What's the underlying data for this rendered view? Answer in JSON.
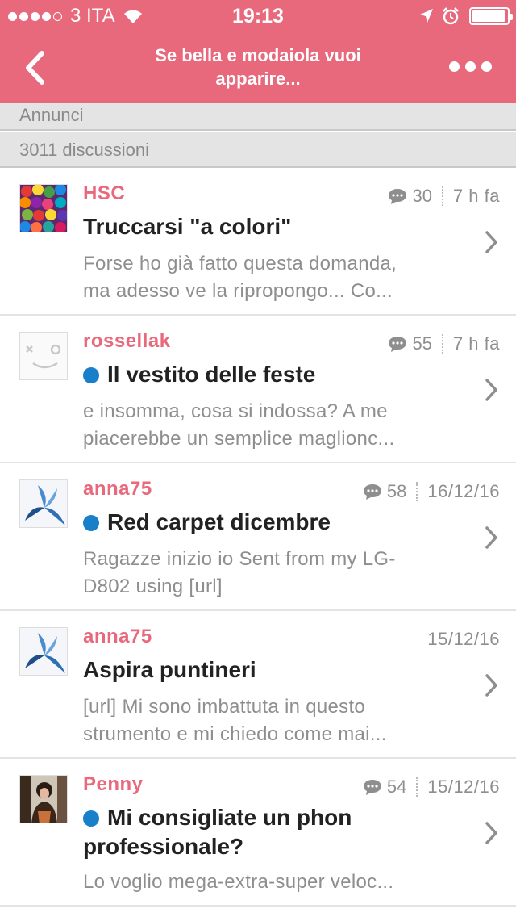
{
  "status_bar": {
    "carrier": "3 ITA",
    "time": "19:13",
    "battery_level": 0.95
  },
  "nav": {
    "title": "Se bella e modaiola vuoi apparire...",
    "back_icon": "chevron-left-icon",
    "more_icon": "ellipsis-icon"
  },
  "sections": {
    "announcements": "Annunci",
    "discussion_count": "3011 discussioni"
  },
  "colors": {
    "brand": "#e8697c",
    "unread": "#1a7fc9"
  },
  "threads": [
    {
      "author": "HSC",
      "replies": "30",
      "date": "7 h fa",
      "unread": false,
      "title": "Truccarsi \"a colori\"",
      "preview_1": "Forse ho già fatto questa domanda,",
      "preview_2": "ma adesso ve la ripropongo... Co..."
    },
    {
      "author": "rossellak",
      "replies": "55",
      "date": "7 h fa",
      "unread": true,
      "title": "Il vestito delle feste",
      "preview_1": "e insomma, cosa si indossa? A me",
      "preview_2": "piacerebbe un semplice maglionc..."
    },
    {
      "author": "anna75",
      "replies": "58",
      "date": "16/12/16",
      "unread": true,
      "title": "Red carpet dicembre",
      "preview_1": "Ragazze inizio io Sent from my LG-",
      "preview_2": "D802 using [url]"
    },
    {
      "author": "anna75",
      "replies": "",
      "date": "15/12/16",
      "unread": false,
      "title": "Aspira puntineri",
      "preview_1": "[url] Mi sono imbattuta in questo",
      "preview_2": "strumento e mi chiedo come mai..."
    },
    {
      "author": "Penny",
      "replies": "54",
      "date": "15/12/16",
      "unread": true,
      "title_1": "Mi consigliate un phon",
      "title_2": "professionale?",
      "preview_1": "Lo voglio mega-extra-super veloc...",
      "preview_2": ""
    }
  ]
}
